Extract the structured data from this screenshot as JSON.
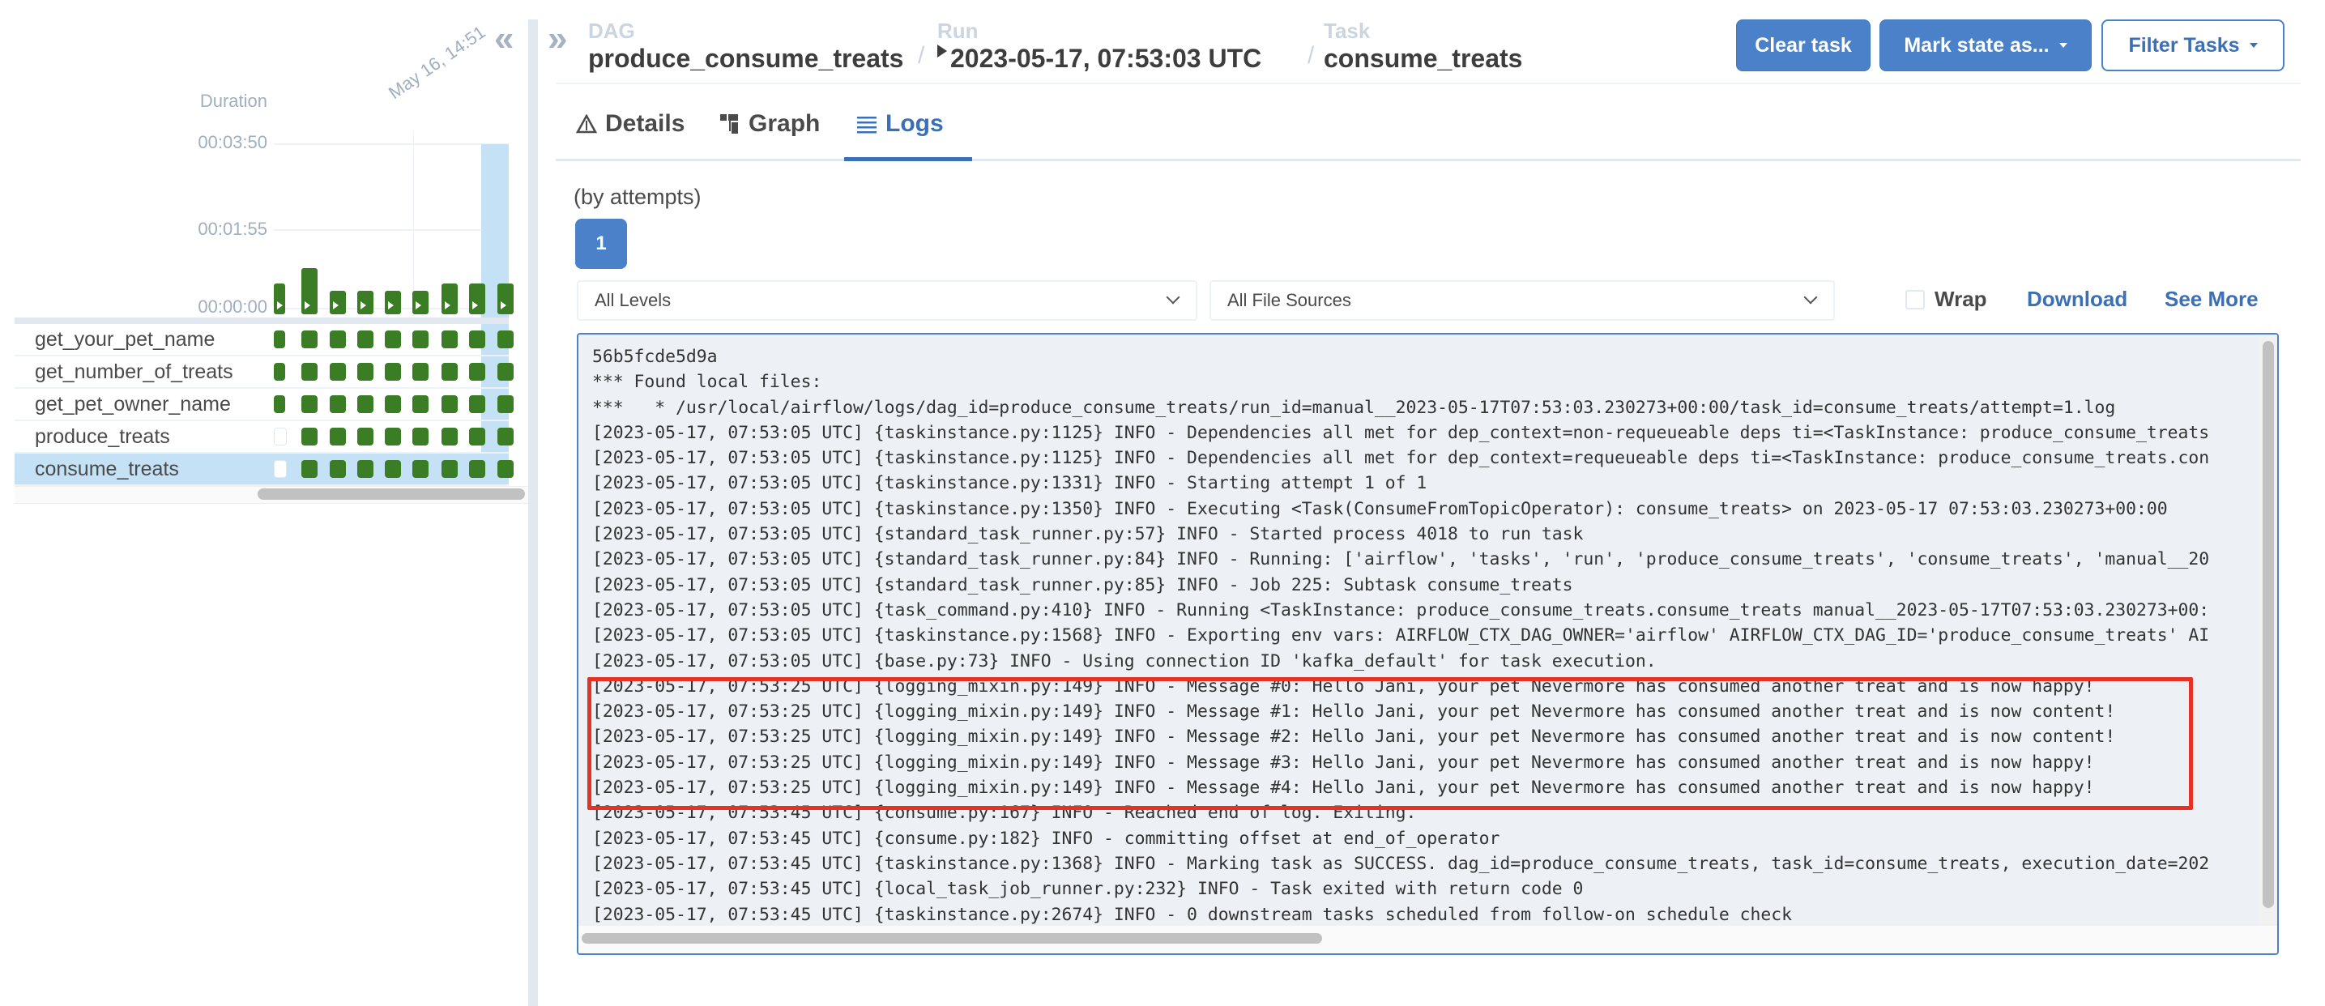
{
  "colors": {
    "accent": "#4a81c8",
    "link": "#3b6fb6",
    "success": "#3a7d24",
    "selected": "#c5e1f5",
    "highlight": "#e53225",
    "log_bg": "#edf1f6"
  },
  "grid": {
    "collapse_icon": "double-chevron-left",
    "duration_label": "Duration",
    "y_ticks": [
      "00:03:50",
      "00:01:55",
      "00:00:00"
    ],
    "date_label": "May 16, 14:51",
    "run_durations_relative": [
      0.18,
      0.27,
      0.14,
      0.14,
      0.14,
      0.14,
      0.18,
      0.18,
      0.18
    ],
    "selected_run_index": 8,
    "tasks": [
      {
        "name": "get_your_pet_name",
        "states": [
          "success",
          "success",
          "success",
          "success",
          "success",
          "success",
          "success",
          "success",
          "success"
        ],
        "selected": false
      },
      {
        "name": "get_number_of_treats",
        "states": [
          "success",
          "success",
          "success",
          "success",
          "success",
          "success",
          "success",
          "success",
          "success"
        ],
        "selected": false
      },
      {
        "name": "get_pet_owner_name",
        "states": [
          "success",
          "success",
          "success",
          "success",
          "success",
          "success",
          "success",
          "success",
          "success"
        ],
        "selected": false
      },
      {
        "name": "produce_treats",
        "states": [
          "none",
          "success",
          "success",
          "success",
          "success",
          "success",
          "success",
          "success",
          "success"
        ],
        "selected": false
      },
      {
        "name": "consume_treats",
        "states": [
          "none",
          "success",
          "success",
          "success",
          "success",
          "success",
          "success",
          "success",
          "success"
        ],
        "selected": true
      }
    ]
  },
  "header": {
    "expand_icon": "double-chevron-right",
    "dag_label": "DAG",
    "dag_value": "produce_consume_treats",
    "run_label": "Run",
    "run_value": "2023-05-17, 07:53:03 UTC",
    "task_label": "Task",
    "task_value": "consume_treats",
    "separator": "/",
    "buttons": {
      "clear_task": "Clear task",
      "mark_state": "Mark state as...",
      "filter_tasks": "Filter Tasks"
    }
  },
  "tabs": [
    {
      "label": "Details",
      "icon": "warning-triangle",
      "active": false
    },
    {
      "label": "Graph",
      "icon": "graph-tree",
      "active": false
    },
    {
      "label": "Logs",
      "icon": "list-lines",
      "active": true
    }
  ],
  "logs": {
    "attempts_label": "(by attempts)",
    "attempts": [
      "1"
    ],
    "selected_attempt": "1",
    "level_filter": "All Levels",
    "source_filter": "All File Sources",
    "wrap_label": "Wrap",
    "wrap_checked": false,
    "download_label": "Download",
    "see_more_label": "See More",
    "highlighted_range": [
      12,
      16
    ],
    "lines": [
      "56b5fcde5d9a",
      "*** Found local files:",
      "***   * /usr/local/airflow/logs/dag_id=produce_consume_treats/run_id=manual__2023-05-17T07:53:03.230273+00:00/task_id=consume_treats/attempt=1.log",
      "[2023-05-17, 07:53:05 UTC] {taskinstance.py:1125} INFO - Dependencies all met for dep_context=non-requeueable deps ti=<TaskInstance: produce_consume_treats",
      "[2023-05-17, 07:53:05 UTC] {taskinstance.py:1125} INFO - Dependencies all met for dep_context=requeueable deps ti=<TaskInstance: produce_consume_treats.con",
      "[2023-05-17, 07:53:05 UTC] {taskinstance.py:1331} INFO - Starting attempt 1 of 1",
      "[2023-05-17, 07:53:05 UTC] {taskinstance.py:1350} INFO - Executing <Task(ConsumeFromTopicOperator): consume_treats> on 2023-05-17 07:53:03.230273+00:00",
      "[2023-05-17, 07:53:05 UTC] {standard_task_runner.py:57} INFO - Started process 4018 to run task",
      "[2023-05-17, 07:53:05 UTC] {standard_task_runner.py:84} INFO - Running: ['airflow', 'tasks', 'run', 'produce_consume_treats', 'consume_treats', 'manual__20",
      "[2023-05-17, 07:53:05 UTC] {standard_task_runner.py:85} INFO - Job 225: Subtask consume_treats",
      "[2023-05-17, 07:53:05 UTC] {task_command.py:410} INFO - Running <TaskInstance: produce_consume_treats.consume_treats manual__2023-05-17T07:53:03.230273+00:",
      "[2023-05-17, 07:53:05 UTC] {taskinstance.py:1568} INFO - Exporting env vars: AIRFLOW_CTX_DAG_OWNER='airflow' AIRFLOW_CTX_DAG_ID='produce_consume_treats' AI",
      "[2023-05-17, 07:53:05 UTC] {base.py:73} INFO - Using connection ID 'kafka_default' for task execution.",
      "[2023-05-17, 07:53:25 UTC] {logging_mixin.py:149} INFO - Message #0: Hello Jani, your pet Nevermore has consumed another treat and is now happy!",
      "[2023-05-17, 07:53:25 UTC] {logging_mixin.py:149} INFO - Message #1: Hello Jani, your pet Nevermore has consumed another treat and is now content!",
      "[2023-05-17, 07:53:25 UTC] {logging_mixin.py:149} INFO - Message #2: Hello Jani, your pet Nevermore has consumed another treat and is now content!",
      "[2023-05-17, 07:53:25 UTC] {logging_mixin.py:149} INFO - Message #3: Hello Jani, your pet Nevermore has consumed another treat and is now happy!",
      "[2023-05-17, 07:53:25 UTC] {logging_mixin.py:149} INFO - Message #4: Hello Jani, your pet Nevermore has consumed another treat and is now happy!",
      "[2023-05-17, 07:53:45 UTC] {consume.py:167} INFO - Reached end of log. Exiting.",
      "[2023-05-17, 07:53:45 UTC] {consume.py:182} INFO - committing offset at end_of_operator",
      "[2023-05-17, 07:53:45 UTC] {taskinstance.py:1368} INFO - Marking task as SUCCESS. dag_id=produce_consume_treats, task_id=consume_treats, execution_date=202",
      "[2023-05-17, 07:53:45 UTC] {local_task_job_runner.py:232} INFO - Task exited with return code 0",
      "[2023-05-17, 07:53:45 UTC] {taskinstance.py:2674} INFO - 0 downstream tasks scheduled from follow-on schedule check"
    ]
  }
}
